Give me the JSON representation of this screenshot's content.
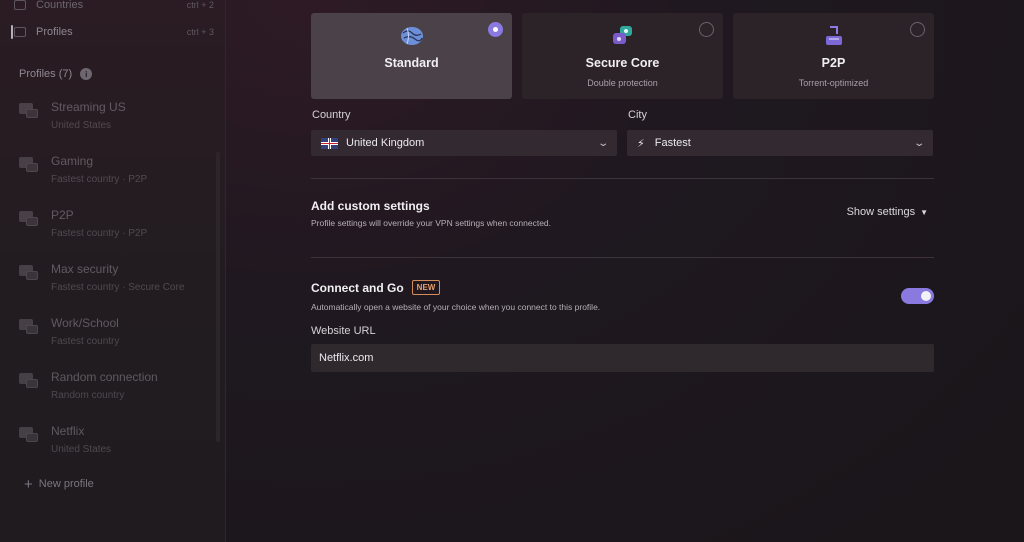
{
  "sidebar": {
    "top_items": [
      {
        "label": "Countries",
        "shortcut": "ctrl + 2"
      },
      {
        "label": "Profiles",
        "shortcut": "ctrl + 3"
      }
    ],
    "profiles_header": "Profiles (7)",
    "profiles": [
      {
        "name": "Streaming US",
        "sub": "United States"
      },
      {
        "name": "Gaming",
        "sub": "Fastest country · P2P"
      },
      {
        "name": "P2P",
        "sub": "Fastest country · P2P"
      },
      {
        "name": "Max security",
        "sub": "Fastest country · Secure Core"
      },
      {
        "name": "Work/School",
        "sub": "Fastest country"
      },
      {
        "name": "Random connection",
        "sub": "Random country"
      },
      {
        "name": "Netflix",
        "sub": "United States"
      }
    ],
    "new_profile": "New profile"
  },
  "types": [
    {
      "title": "Standard",
      "subtitle": "",
      "selected": true,
      "icon": "globe-icon"
    },
    {
      "title": "Secure Core",
      "subtitle": "Double protection",
      "selected": false,
      "icon": "secure-core-icon"
    },
    {
      "title": "P2P",
      "subtitle": "Torrent-optimized",
      "selected": false,
      "icon": "p2p-icon"
    }
  ],
  "country": {
    "label": "Country",
    "value": "United Kingdom"
  },
  "city": {
    "label": "City",
    "value": "Fastest"
  },
  "custom_settings": {
    "title": "Add custom settings",
    "desc": "Profile settings will override your VPN settings when connected.",
    "action": "Show settings"
  },
  "connect_go": {
    "title": "Connect and Go",
    "badge": "NEW",
    "desc": "Automatically open a website of your choice when you connect to this profile.",
    "enabled": true,
    "url_label": "Website URL",
    "url_value": "Netflix.com"
  },
  "colors": {
    "accent": "#8a7ae0",
    "badge": "#e7a069"
  }
}
